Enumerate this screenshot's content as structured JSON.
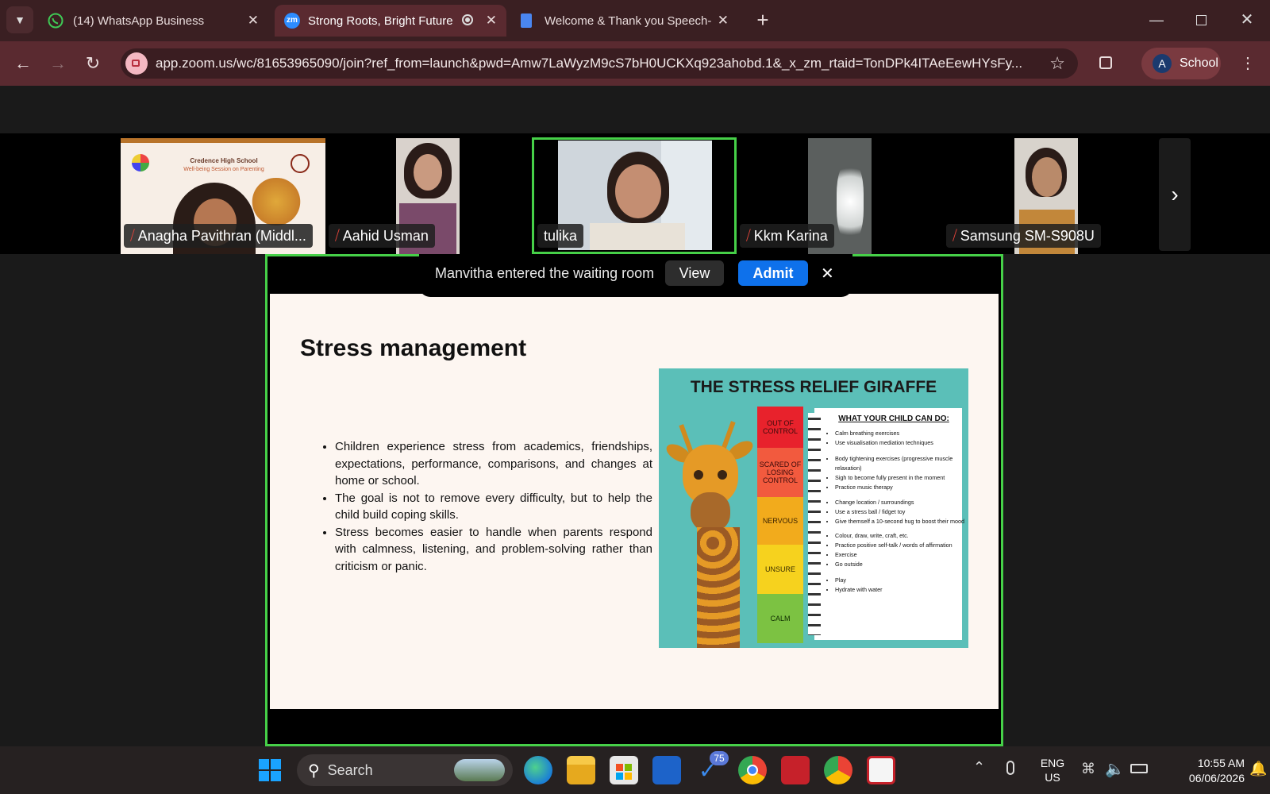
{
  "browser": {
    "tabs": [
      {
        "title": "(14) WhatsApp Business",
        "icon": "whatsapp-icon"
      },
      {
        "title": "Strong Roots, Bright Future:",
        "icon": "zoom-icon",
        "active": true
      },
      {
        "title": "Welcome & Thank you Speech-",
        "icon": "docs-icon"
      }
    ],
    "url": "app.zoom.us/wc/81653965090/join?ref_from=launch&pwd=Amw7LaWyzM9cS7bH0UCKXq923ahobd.1&_x_zm_rtaid=TonDPk4ITAeEewHYsFy...",
    "profile_initial": "A",
    "profile_name": "School",
    "zoom_favicon_text": "zm"
  },
  "participants": [
    {
      "name": "Anagha Pavithran (Middl...",
      "muted": true,
      "banner_title": "Credence High School",
      "banner_sub": "Well-being Session on Parenting"
    },
    {
      "name": "Aahid Usman",
      "muted": true
    },
    {
      "name": "tulika",
      "muted": false,
      "active_speaker": true
    },
    {
      "name": "Kkm Karina",
      "muted": true
    },
    {
      "name": "Samsung SM-S908U",
      "muted": true
    }
  ],
  "waiting_notice": {
    "text": "Manvitha entered the waiting room",
    "view_label": "View",
    "admit_label": "Admit",
    "close_label": "✕"
  },
  "slide": {
    "title": "Stress management",
    "bullets": [
      "Children experience stress from academics, friendships, expectations, performance, comparisons, and changes at home or school.",
      "The goal is not to remove every difficulty, but to help the child build coping skills.",
      "Stress becomes easier to handle when parents respond with calmness, listening, and problem-solving rather than criticism or panic."
    ],
    "poster": {
      "title": "THE STRESS RELIEF GIRAFFE",
      "levels": [
        {
          "label": "OUT OF CONTROL",
          "color": "#e8222c"
        },
        {
          "label": "SCARED OF LOSING CONTROL",
          "color": "#f25a3e"
        },
        {
          "label": "NERVOUS",
          "color": "#f2ab1c"
        },
        {
          "label": "UNSURE",
          "color": "#f6d21e"
        },
        {
          "label": "CALM",
          "color": "#7cc242"
        }
      ],
      "list_title": "WHAT YOUR CHILD CAN DO:",
      "items": [
        "Calm breathing exercises",
        "Use visualisation mediation techniques",
        "Body tightening exercises (progressive muscle relaxation)",
        "Sigh to become fully present in the moment",
        "Practice music therapy",
        "Change location / surroundings",
        "Use a stress ball / fidget toy",
        "Give themself a 10-second hug to boost their mood",
        "Colour, draw, write, craft, etc.",
        "Practice positive self-talk / words of affirmation",
        "Exercise",
        "Go outside",
        "Play",
        "Hydrate with water"
      ]
    }
  },
  "taskbar": {
    "search_placeholder": "Search",
    "badge_count": "75",
    "lang_top": "ENG",
    "lang_bottom": "US",
    "time": "10:55 AM",
    "date": "06/06/2026"
  },
  "colors": {
    "tabbar": "#3a1f22",
    "toolbar": "#5a2a30",
    "active_speaker": "#46d048",
    "admit": "#0e71eb",
    "taskbar": "#262121"
  }
}
